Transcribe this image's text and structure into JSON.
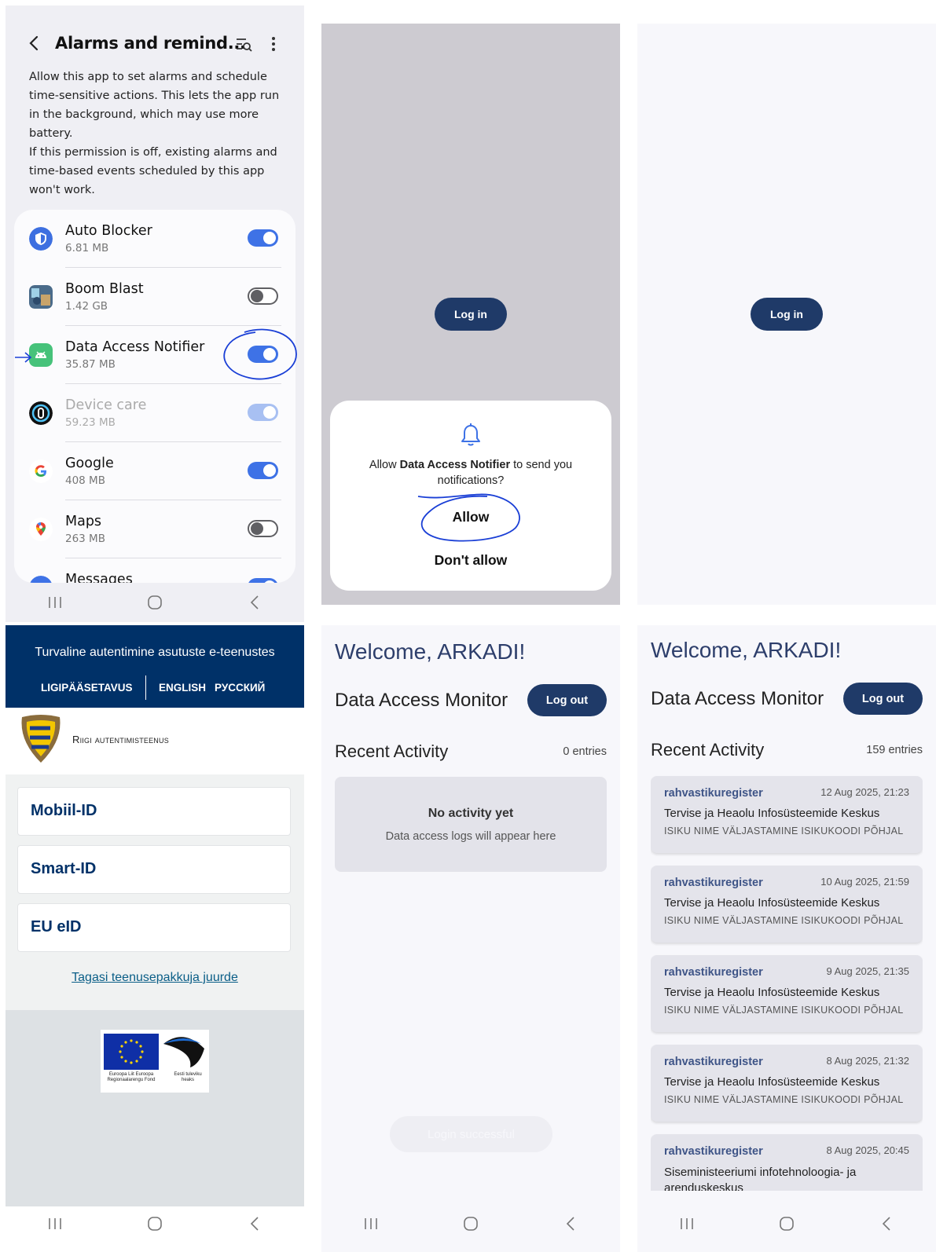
{
  "settings": {
    "title": "Alarms and remind...",
    "desc1": "Allow this app to set alarms and schedule time-sensitive actions. This lets the app run in the background, which may use more battery.",
    "desc2": "If this permission is off, existing alarms and time-based events scheduled by this app won't work.",
    "apps": [
      {
        "name": "Auto Blocker",
        "size": "6.81 MB",
        "enabled": true
      },
      {
        "name": "Boom Blast",
        "size": "1.42 GB",
        "enabled": false
      },
      {
        "name": "Data Access Notifier",
        "size": "35.87 MB",
        "enabled": true
      },
      {
        "name": "Device care",
        "size": "59.23 MB",
        "enabled": true,
        "disabled": true
      },
      {
        "name": "Google",
        "size": "408 MB",
        "enabled": true
      },
      {
        "name": "Maps",
        "size": "263 MB",
        "enabled": false
      },
      {
        "name": "Messages",
        "size": "",
        "enabled": true
      }
    ]
  },
  "notif_dialog": {
    "login_label": "Log in",
    "text_pre": "Allow ",
    "app_name": "Data Access Notifier",
    "text_post": " to send you notifications?",
    "allow": "Allow",
    "deny": "Don't allow"
  },
  "blank_login": {
    "login_label": "Log in"
  },
  "auth": {
    "heading": "Turvaline autentimine asutuste e-teenustes",
    "lang_access": "LIGIPÄÄSETAVUS",
    "lang_en": "ENGLISH",
    "lang_ru": "РУССКИЙ",
    "brand": "Riigi autentimisteenus",
    "options": [
      "Mobiil-ID",
      "Smart-ID",
      "EU eID"
    ],
    "back_link": "Tagasi teenusepakkuja juurde",
    "eu_text": "Euroopa Liit Euroopa Regionaalarengu Fond",
    "ee_text": "Eesti tuleviku heaks"
  },
  "monitor_empty": {
    "welcome": "Welcome, ARKADI!",
    "title": "Data Access Monitor",
    "logout": "Log out",
    "recent": "Recent Activity",
    "entries": "0 entries",
    "empty_title": "No activity yet",
    "empty_sub": "Data access logs will appear here",
    "toast": "Login successful"
  },
  "monitor_full": {
    "welcome": "Welcome, ARKADI!",
    "title": "Data Access Monitor",
    "logout": "Log out",
    "recent": "Recent Activity",
    "entries": "159 entries",
    "activities": [
      {
        "registry": "rahvastikuregister",
        "date": "12 Aug 2025, 21:23",
        "org": "Tervise ja Heaolu Infosüsteemide Keskus",
        "action": "ISIKU NIME VÄLJASTAMINE ISIKUKOODI PÕHJAL"
      },
      {
        "registry": "rahvastikuregister",
        "date": "10 Aug 2025, 21:59",
        "org": "Tervise ja Heaolu Infosüsteemide Keskus",
        "action": "ISIKU NIME VÄLJASTAMINE ISIKUKOODI PÕHJAL"
      },
      {
        "registry": "rahvastikuregister",
        "date": "9 Aug 2025, 21:35",
        "org": "Tervise ja Heaolu Infosüsteemide Keskus",
        "action": "ISIKU NIME VÄLJASTAMINE ISIKUKOODI PÕHJAL"
      },
      {
        "registry": "rahvastikuregister",
        "date": "8 Aug 2025, 21:32",
        "org": "Tervise ja Heaolu Infosüsteemide Keskus",
        "action": "ISIKU NIME VÄLJASTAMINE ISIKUKOODI PÕHJAL"
      },
      {
        "registry": "rahvastikuregister",
        "date": "8 Aug 2025, 20:45",
        "org": "Siseministeeriumi infotehnoloogia- ja arenduskeskus",
        "action": ""
      }
    ]
  },
  "colors": {
    "accent": "#1f3a68",
    "toggle_on": "#3e72e6",
    "ee_blue": "#003168",
    "annotation": "#1a3fd6"
  }
}
